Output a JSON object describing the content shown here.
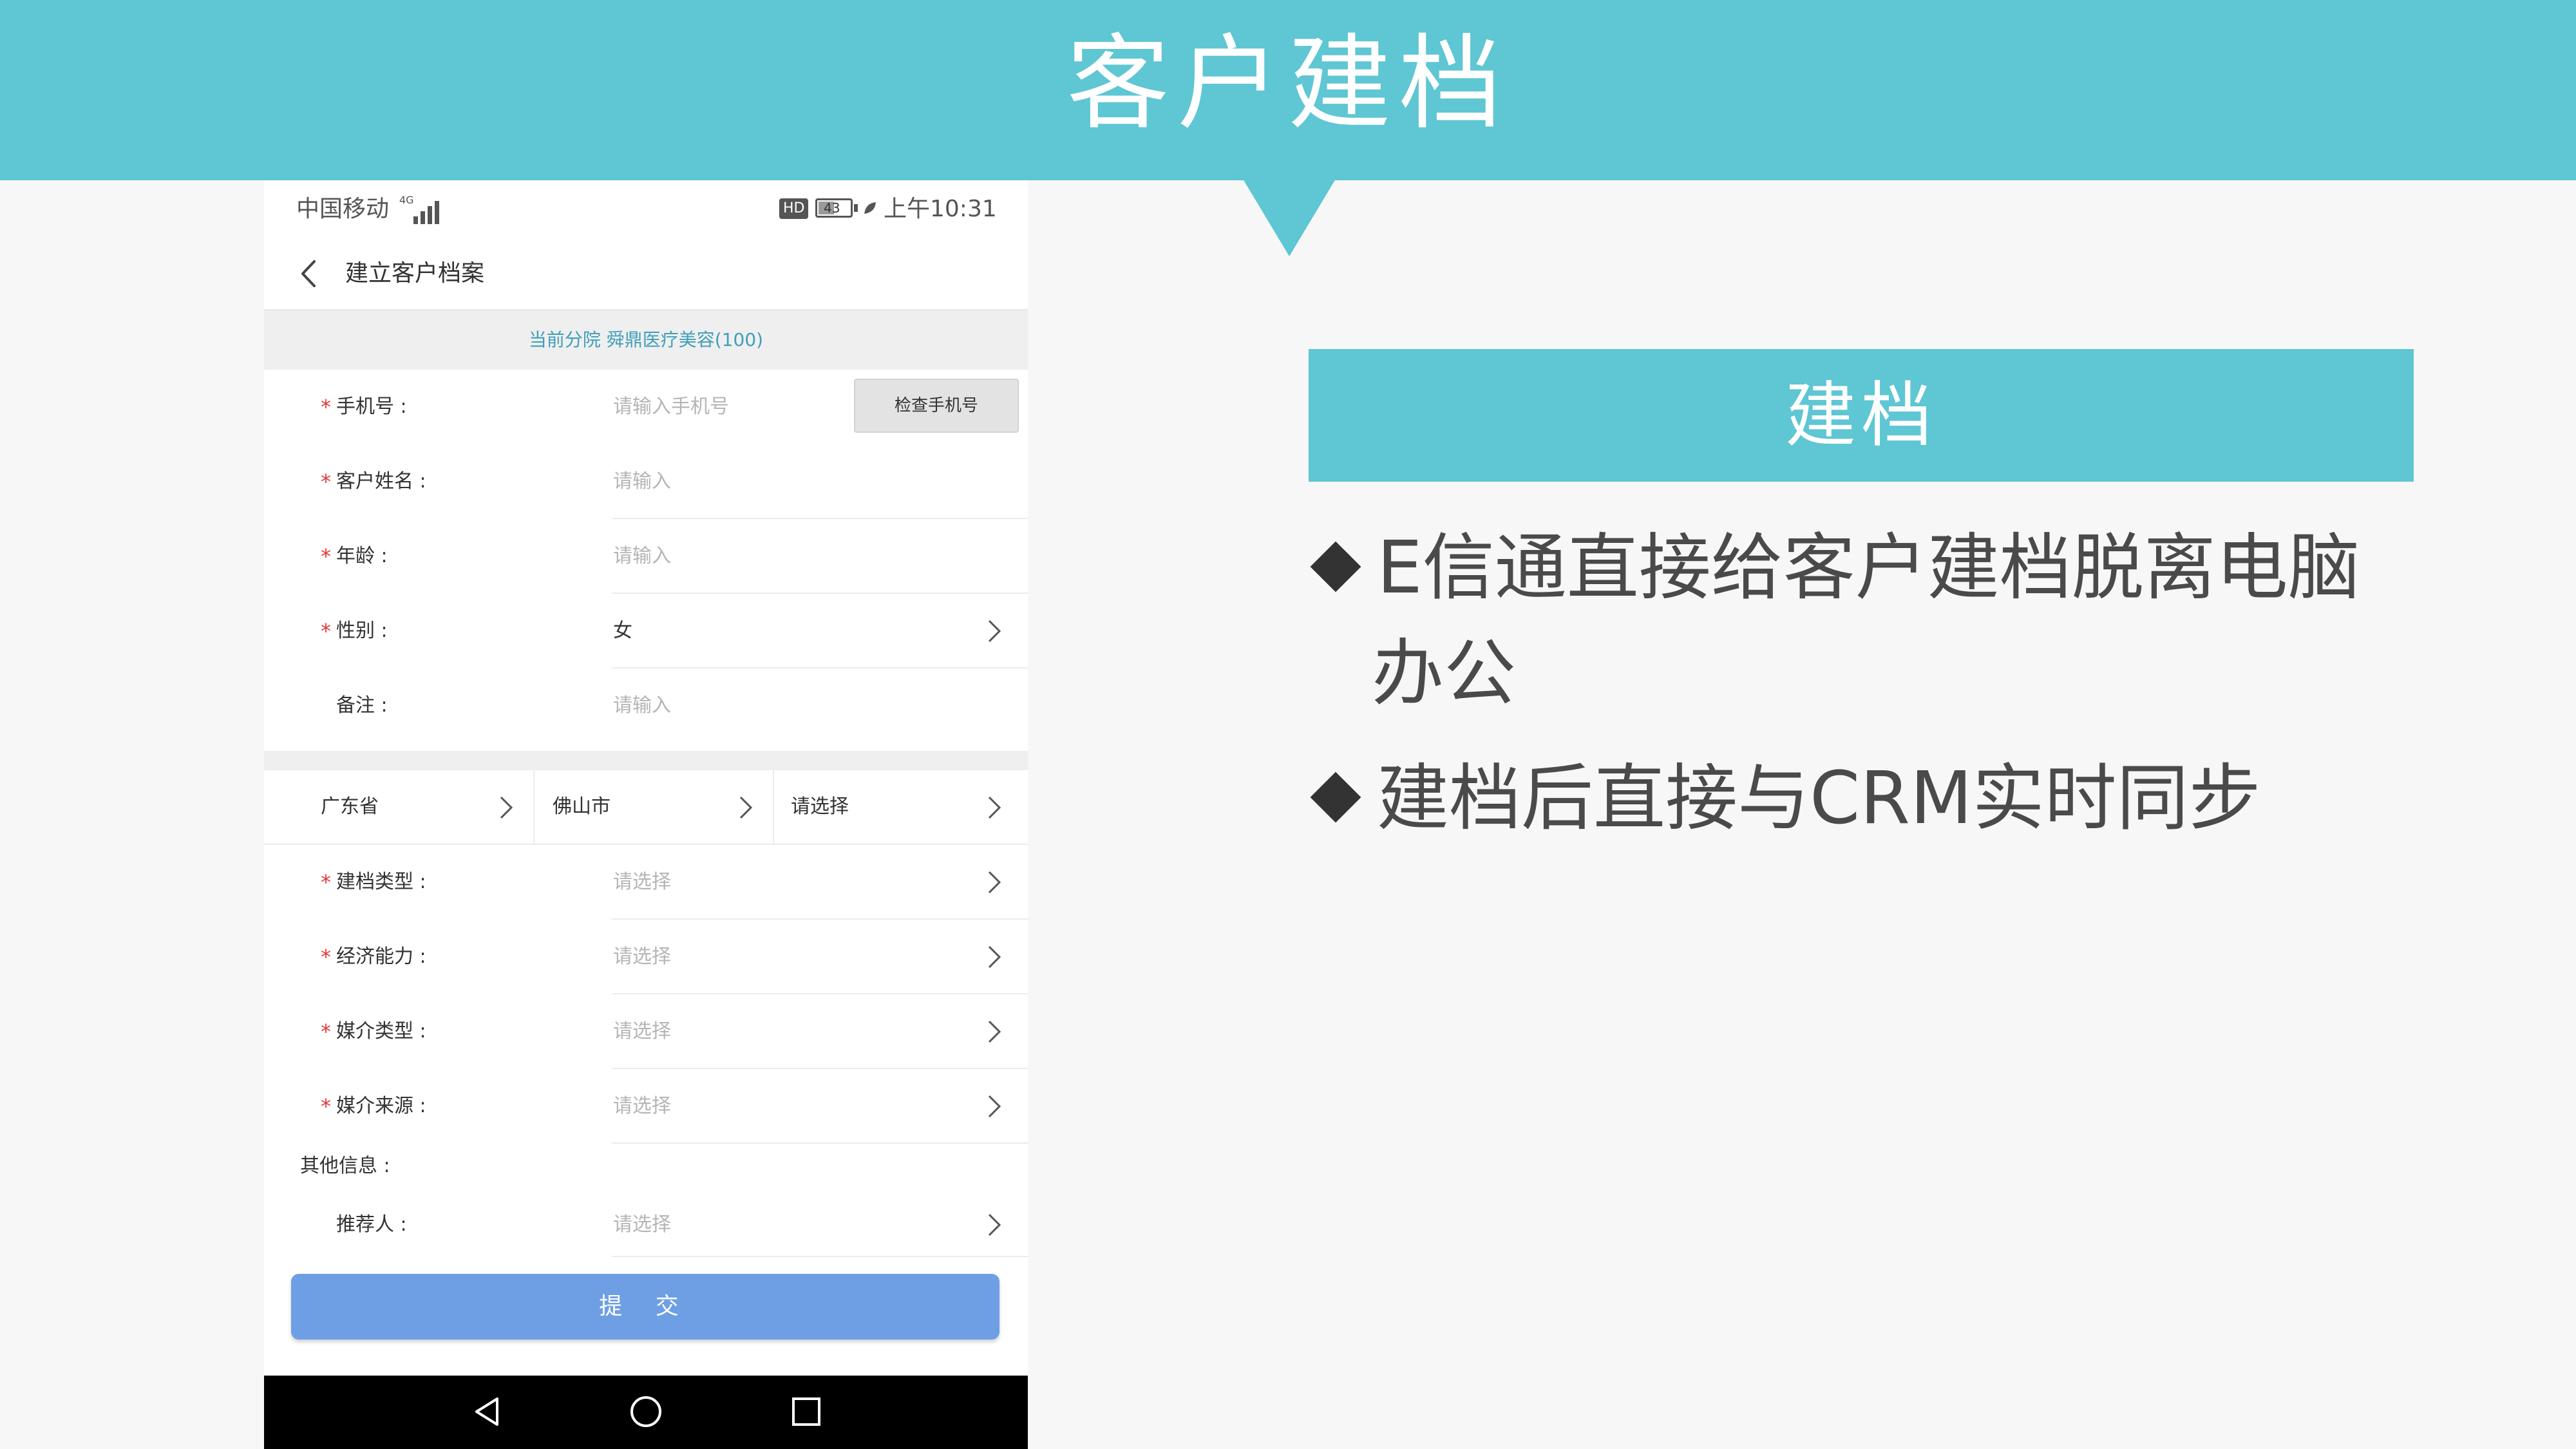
{
  "slide": {
    "title": "客户建档",
    "feature_title": "建档",
    "bullets": [
      {
        "line1": "E信通直接给客户建档脱离电脑",
        "line2": "办公"
      },
      {
        "line1": "建档后直接与CRM实时同步",
        "line2": ""
      }
    ],
    "colors": {
      "accent": "#5fc6d3",
      "submit": "#6e9fe4",
      "required": "#e23b3b",
      "branch_text": "#3f9fb8"
    }
  },
  "phone": {
    "status": {
      "carrier": "中国移动",
      "network": "4G",
      "hd": "HD",
      "battery": "43",
      "time": "上午10:31"
    },
    "nav": {
      "title": "建立客户档案",
      "back_icon": "chevron-left-icon"
    },
    "branch": "当前分院 舜鼎医疗美容(100)",
    "fields": {
      "phone": {
        "label": "手机号 :",
        "placeholder": "请输入手机号",
        "button": "检查手机号",
        "required": "*"
      },
      "name": {
        "label": "客户姓名 :",
        "placeholder": "请输入",
        "required": "*"
      },
      "age": {
        "label": "年龄 :",
        "placeholder": "请输入",
        "required": "*"
      },
      "gender": {
        "label": "性别 :",
        "value": "女",
        "required": "*"
      },
      "remark": {
        "label": "备注 :",
        "placeholder": "请输入"
      }
    },
    "region": {
      "province": "广东省",
      "city": "佛山市",
      "district": "请选择"
    },
    "selects": {
      "archive_type": {
        "label": "建档类型 :",
        "value": "请选择",
        "required": "*"
      },
      "economic": {
        "label": "经济能力 :",
        "value": "请选择",
        "required": "*"
      },
      "media_type": {
        "label": "媒介类型 :",
        "value": "请选择",
        "required": "*"
      },
      "media_source": {
        "label": "媒介来源 :",
        "value": "请选择",
        "required": "*"
      }
    },
    "other_info": "其他信息 :",
    "referrer": {
      "label": "推荐人 :",
      "value": "请选择"
    },
    "submit": "提 交",
    "sys_nav": [
      "back-triangle-icon",
      "home-circle-icon",
      "recents-square-icon"
    ]
  }
}
